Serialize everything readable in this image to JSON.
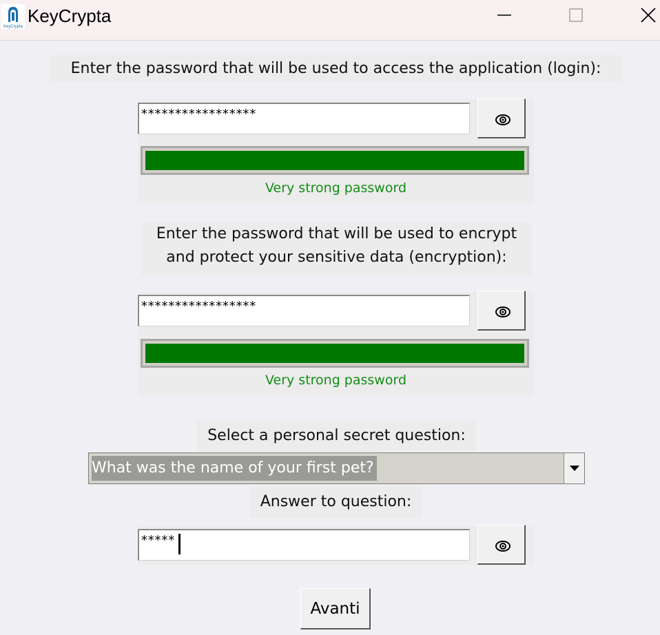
{
  "window": {
    "title": "KeyCrypta",
    "logo_text": "KeyCrypta"
  },
  "login": {
    "label": "Enter the password that will be used to access the application (login):",
    "value": "*****************",
    "strength_fraction": 1.0,
    "strength_label": "Very strong password"
  },
  "encryption": {
    "label_line1": "Enter the password that will be used to encrypt",
    "label_line2": "and protect your sensitive data (encryption):",
    "value": "*****************",
    "strength_fraction": 1.0,
    "strength_label": "Very strong password"
  },
  "question": {
    "label": "Select a personal secret question:",
    "selected": "What was the name of your first pet?"
  },
  "answer": {
    "label": "Answer to question:",
    "value": "*****"
  },
  "buttons": {
    "next_label": "Avanti"
  },
  "colors": {
    "strength_bar": "#007800",
    "strength_text": "#148c14"
  },
  "icons": {
    "reveal": "eye-icon",
    "dropdown": "triangle-down-icon",
    "minimize": "minimize-icon",
    "maximize": "maximize-icon",
    "close": "close-icon"
  }
}
